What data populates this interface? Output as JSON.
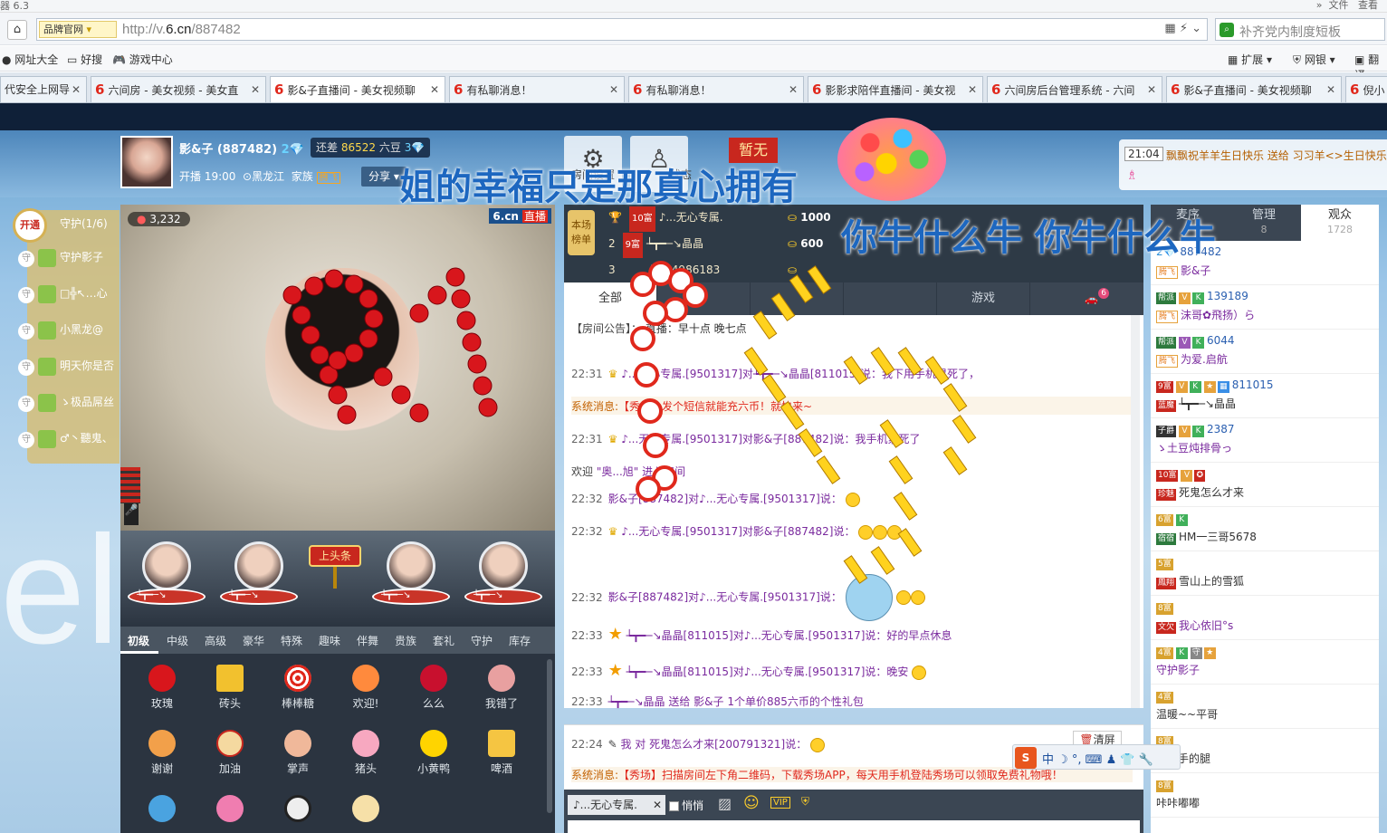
{
  "browser": {
    "top_title": "器 6.3",
    "top_right": [
      "»",
      "文件",
      "查看"
    ],
    "brand_tag": "品牌官网",
    "url_prefix": "http://v.",
    "url_domain": "6.cn",
    "url_path": "/887482",
    "search_placeholder": "补齐党内制度短板",
    "favorites": [
      "网址大全",
      "好搜",
      "游戏中心"
    ],
    "toolbar_right": [
      "扩展",
      "网银",
      "翻译"
    ],
    "tabs": [
      {
        "label": "代安全上网导",
        "active": false
      },
      {
        "label": "六间房 - 美女视频 - 美女直",
        "active": false
      },
      {
        "label": "影&子直播间 - 美女视频聊",
        "active": true
      },
      {
        "label": "有私聊消息！",
        "active": false
      },
      {
        "label": "有私聊消息！",
        "active": false
      },
      {
        "label": "影影求陪伴直播间 - 美女视",
        "active": false
      },
      {
        "label": "六间房后台管理系统 - 六间",
        "active": false
      },
      {
        "label": "影&子直播间 - 美女视频聊",
        "active": false
      },
      {
        "label": "倪小",
        "active": false
      }
    ]
  },
  "room": {
    "anchor_name": "影&子 (887482)",
    "need_text": "还差",
    "need_value": "86522",
    "need_unit": "六豆",
    "start_time": "开播 19:00",
    "location": "黑龙江",
    "family_label": "家族",
    "family_badge": "腾飞",
    "share_label": "分享",
    "settings_label": "房间设置",
    "status_label": "状态",
    "not_live": "暂无",
    "ticker_time": "21:04",
    "ticker_msg": "飘飘祝羊羊生日快乐 送给 习习羊<>生日快乐",
    "danmu": [
      "姐的幸福只是那真心拥有",
      "你牛什么牛  你牛什么牛"
    ]
  },
  "guard": {
    "open_label": "开通",
    "title": "守护(1/6)",
    "members": [
      "守护影子",
      "□╬↖…心",
      "小黑龙@",
      "明天你是否",
      "ゝ极品屌丝",
      "♂丶聽鬼、"
    ]
  },
  "video": {
    "viewers": "3,232",
    "logo": "6.cn",
    "live_tag": "直播"
  },
  "seats": {
    "headline_label": "上头条",
    "seat_names": [
      "┶┳━─↘",
      "┶┳━─↘",
      "┶┳━─↘",
      "┶┳━─↘"
    ]
  },
  "gifts": {
    "tabs": [
      "初级",
      "中级",
      "高级",
      "豪华",
      "特殊",
      "趣味",
      "伴舞",
      "贵族",
      "套礼",
      "守护",
      "库存"
    ],
    "items": [
      "玫瑰",
      "砖头",
      "棒棒糖",
      "欢迎!",
      "么么",
      "我错了",
      "谢谢",
      "加油",
      "掌声",
      "猪头",
      "小黄鸭",
      "啤酒",
      "",
      "",
      "",
      ""
    ]
  },
  "rank": {
    "badge": "本场榜单",
    "rows": [
      {
        "pos": "1",
        "level": "10富",
        "name": "♪...无心专属.",
        "value": "1000"
      },
      {
        "pos": "2",
        "level": "9富",
        "name": "┶┳━─↘晶晶",
        "value": "600"
      },
      {
        "pos": "3",
        "level": "",
        "name": "无名4986183",
        "value": ""
      }
    ]
  },
  "chat": {
    "tabs": [
      "全部",
      "",
      "",
      "游戏"
    ],
    "car_count": "6",
    "notice_label": "【房间公告】：",
    "notice_text": "直播：早十点 晚七点",
    "lines": [
      {
        "time": "22:31",
        "text": "♪...无心专属.[9501317]对┶┳━─↘晶晶[811015]说：我下用手机累死了，"
      },
      {
        "time": "系统消息:",
        "text": "【秀场】发个短信就能充六币！就快来~"
      },
      {
        "time": "22:31",
        "text": "♪...无心专属.[9501317]对影&子[887482]说：我手机累死了"
      },
      {
        "time": "欢迎",
        "text": "\"奥...旭\" 进入房间"
      },
      {
        "time": "22:32",
        "text": "影&子[887482]对♪...无心专属.[9501317]说："
      },
      {
        "time": "22:32",
        "text": "♪...无心专属.[9501317]对影&子[887482]说："
      },
      {
        "time": "22:32",
        "text": "影&子[887482]对♪...无心专属.[9501317]说："
      },
      {
        "time": "22:33",
        "text": "┶┳━─↘晶晶[811015]对♪...无心专属.[9501317]说：好的早点休息"
      },
      {
        "time": "22:33",
        "text": "┶┳━─↘晶晶[811015]对♪...无心专属.[9501317]说：晚安"
      },
      {
        "time": "22:33",
        "text": "┶┳━─↘晶晶 送给 影&子 1个单价885六币的个性礼包"
      }
    ],
    "private_time": "22:24",
    "private_text": "我 对 死鬼怎么才来[200791321]说：",
    "clear_label": "清屏",
    "sys_label": "系统消息:",
    "sys_text": "【秀场】扫描房间左下角二维码，下载秀场APP，每天用手机登陆秀场可以领取免费礼物哦！",
    "target": "♪...无心专属.",
    "quiet_label": "悄悄"
  },
  "right": {
    "tabs": [
      {
        "label": "麦序",
        "count": ""
      },
      {
        "label": "管理",
        "count": "8"
      },
      {
        "label": "观众",
        "count": "1728"
      }
    ],
    "users": [
      {
        "level": "2",
        "tags": "",
        "id": "887482",
        "badge": "腾飞",
        "name": "影&子"
      },
      {
        "level": "帮派",
        "tags": "VK",
        "id": "139189",
        "badge": "腾飞",
        "name": "沫哥✿飛扬）ら"
      },
      {
        "level": "帮派",
        "tags": "VK",
        "id": "6044",
        "badge": "腾飞",
        "name": "为爱.启航"
      },
      {
        "level": "9富",
        "tags": "VK",
        "id": "811015",
        "badge": "蓝魔",
        "name": "┶┳━─↘晶晶"
      },
      {
        "level": "子爵",
        "tags": "VK",
        "id": "2387",
        "badge": "",
        "name": "ゝ土豆炖排骨っ"
      },
      {
        "level": "10富",
        "tags": "V",
        "id": "",
        "badge": "珍魅",
        "name": "死鬼怎么才来"
      },
      {
        "level": "6富",
        "tags": "K",
        "id": "",
        "badge": "宿宿",
        "name": "HM一三哥5678"
      },
      {
        "level": "5富",
        "tags": "",
        "id": "",
        "badge": "鳳翔",
        "name": "雪山上的雪狐"
      },
      {
        "level": "8富",
        "tags": "",
        "id": "",
        "badge": "文欠",
        "name": "我心依旧°s"
      },
      {
        "level": "4富",
        "tags": "K守",
        "id": "",
        "badge": "",
        "name": "守护影子"
      },
      {
        "level": "4富",
        "tags": "",
        "id": "",
        "badge": "",
        "name": "温暖~~平哥"
      },
      {
        "level": "8富",
        "tags": "",
        "id": "",
        "badge": "",
        "name": "火炬手的腿"
      },
      {
        "level": "8富",
        "tags": "",
        "id": "",
        "badge": "",
        "name": "咔咔嘟嘟"
      }
    ]
  },
  "ime": {
    "logo": "S",
    "chars": "中 ☽ °, ⌨ ♟ 👕 🔧"
  }
}
